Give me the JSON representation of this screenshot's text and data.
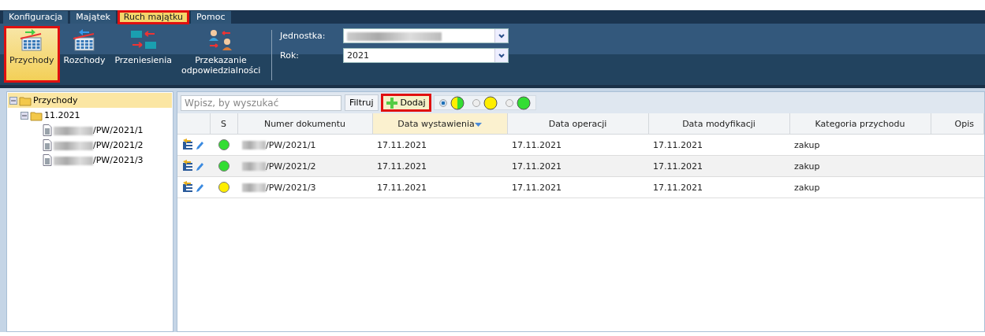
{
  "menu_tabs": [
    {
      "label": "Konfiguracja",
      "selected": false,
      "highlighted": false
    },
    {
      "label": "Majątek",
      "selected": false,
      "highlighted": false
    },
    {
      "label": "Ruch majątku",
      "selected": true,
      "highlighted": true
    },
    {
      "label": "Pomoc",
      "selected": false,
      "highlighted": false
    }
  ],
  "toolbar": {
    "buttons": [
      {
        "label": "Przychody",
        "kind": "incoming",
        "selected": true,
        "highlighted": true
      },
      {
        "label": "Rozchody",
        "kind": "outgoing",
        "selected": false,
        "highlighted": false
      },
      {
        "label": "Przeniesienia",
        "kind": "transfer",
        "selected": false,
        "highlighted": false
      },
      {
        "label": "Przekazanie odpowiedzialności",
        "kind": "handover",
        "selected": false,
        "highlighted": false
      }
    ],
    "fields": [
      {
        "label": "Jednostka:",
        "redacted": true
      },
      {
        "label": "Rok:",
        "value": "2021",
        "redacted": false
      }
    ]
  },
  "tree": {
    "label": "Przychody",
    "expanded": true,
    "selected": true,
    "children": [
      {
        "label": "11.2021",
        "expanded": true,
        "selected": false,
        "children": [
          {
            "label": "/PW/2021/1",
            "redacted": true,
            "selected": false
          },
          {
            "label": "/PW/2021/2",
            "redacted": true,
            "selected": false
          },
          {
            "label": "/PW/2021/3",
            "redacted": true,
            "selected": false
          }
        ]
      }
    ]
  },
  "search": {
    "placeholder": "Wpisz, by wyszukać"
  },
  "filter_button": "Filtruj",
  "add_button": {
    "label": "Dodaj",
    "highlighted": true
  },
  "status_filters": [
    {
      "selected": true,
      "kind": "mixed"
    },
    {
      "selected": false,
      "kind": "single",
      "color": "#ffee00"
    },
    {
      "selected": false,
      "kind": "single",
      "color": "#33dd33"
    }
  ],
  "table": {
    "columns": [
      {
        "sorted": false
      },
      {
        "label": "S",
        "sorted": false
      },
      {
        "label": "Numer dokumentu",
        "sorted": false
      },
      {
        "label": "Data wystawienia",
        "sorted": true
      },
      {
        "label": "Data operacji",
        "sorted": false
      },
      {
        "label": "Data modyfikacji",
        "sorted": false
      },
      {
        "label": "Kategoria przychodu",
        "sorted": false
      },
      {
        "label": "Opis",
        "sorted": false
      }
    ],
    "rows": [
      {
        "color": "#33dd33",
        "number": "/PW/2021/1",
        "number_redacted": true,
        "issued": "17.11.2021",
        "operation": "17.11.2021",
        "modified": "17.11.2021",
        "category": "zakup"
      },
      {
        "color": "#33dd33",
        "number": "/PW/2021/2",
        "number_redacted": true,
        "issued": "17.11.2021",
        "operation": "17.11.2021",
        "modified": "17.11.2021",
        "category": "zakup"
      },
      {
        "color": "#ffee00",
        "number": "/PW/2021/3",
        "number_redacted": true,
        "issued": "17.11.2021",
        "operation": "17.11.2021",
        "modified": "17.11.2021",
        "category": "zakup"
      }
    ]
  }
}
